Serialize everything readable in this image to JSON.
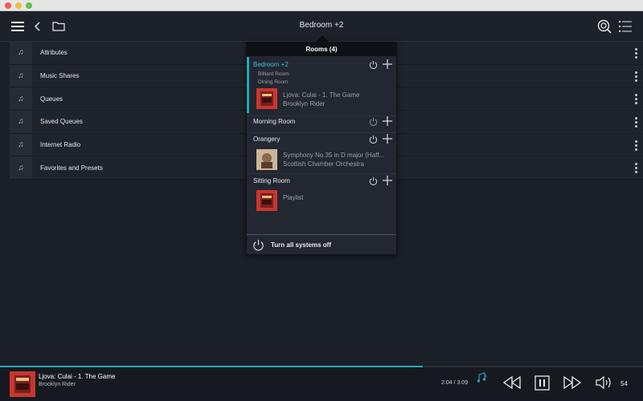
{
  "toolbar": {
    "title": "Bedroom +2"
  },
  "sidebar": {
    "items": [
      {
        "label": "Attributes"
      },
      {
        "label": "Music Shares"
      },
      {
        "label": "Queues"
      },
      {
        "label": "Saved Queues"
      },
      {
        "label": "Internet Radio"
      },
      {
        "label": "Favorites and Presets"
      }
    ]
  },
  "rooms": {
    "header": "Rooms (4)",
    "items": [
      {
        "name": "Bedroom +2",
        "linked": [
          "Billiard Room",
          "Dining Room"
        ],
        "track": "Ljova: Culai - 1. The Game",
        "artist": "Brooklyn Rider"
      },
      {
        "name": "Morning Room"
      },
      {
        "name": "Orangery",
        "track": "Symphony No.35 in D major (Haff...",
        "artist": "Scottish Chamber Orchestra"
      },
      {
        "name": "Sitting Room",
        "track": "Playlist"
      }
    ],
    "footer": "Turn all systems off"
  },
  "player": {
    "title": "Ljova: Culai - 1. The Game",
    "artist": "Brooklyn Rider",
    "time": "2:04 / 3:09",
    "progress": 0.657,
    "volume": "54"
  },
  "colors": {
    "accent": "#23a6bb",
    "active_room": "#3cc0d4"
  },
  "icons": [
    "menu-icon",
    "back-icon",
    "folder-icon",
    "search-icon",
    "queue-list-icon",
    "music-note-icon",
    "power-icon",
    "plus-icon",
    "rewind-icon",
    "pause-icon",
    "forward-icon",
    "volume-icon"
  ]
}
